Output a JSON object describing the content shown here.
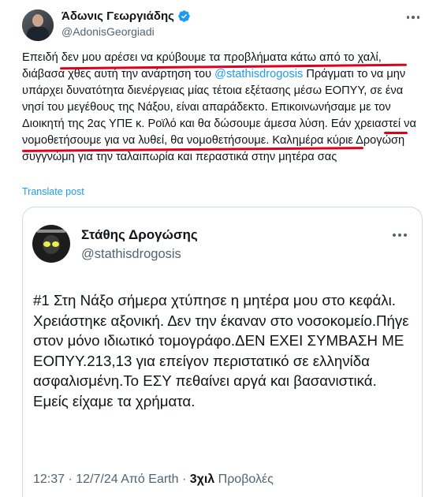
{
  "tweet": {
    "author_name": "Άδωνις Γεωργιάδης",
    "author_handle": "@AdonisGeorgiadi",
    "text_segments": [
      "Επειδή ",
      "δεν μου αρέσει να κρύβουμε τα προβλήματα κάτω από το χαλί",
      ", διάβασα χθες αυτή την ανάρτηση του ",
      "@stathisdrogosis",
      " Πράγματι το να μην υπάρχει δυνατότητα διενέργειας μίας τέτοια εξέτασης μέσω ΕΟΠΥΥ, σε ένα νησί του μεγέθους της Νάξου, είναι απαράδεκτο. Επικοινωνήσαμε με τον Διοικητή της 2ας ΥΠΕ κ. Ροϊλό και θα δώσουμε άμεσα λύση. ",
      "Εάν χρειαστεί να νομοθετήσουμε για να λυθεί, θα νομοθετήσουμε.",
      " Καλημέρα κύριε Δρογώση συγγνώμη για την ταλαιπωρία και περαστικά στην μητέρα σας"
    ],
    "translate_label": "Translate post"
  },
  "quoted": {
    "author_name": "Στάθης Δρογώσης",
    "author_handle": "@stathisdrogosis",
    "text": "#1 Στη Νάξο σήμερα χτύπησε η μητέρα μου στο κεφάλι. Χρειάστηκε αξονική. Δεν την έκαναν στο νοσοκομείο.Πήγε στον μόνο ιδιωτικό τομογράφο.ΔΕΝ ΕΧΕΙ ΣΥΜΒΑΣΗ ΜΕ ΕΟΠΥΥ.213,13 για επείγον περιστατικό σε ελληνίδα ασφαλισμένη.Το ΕΣΥ πεθαίνει αργά και βασανιστικά. Εμείς είχαμε τα χρήματα.",
    "time": "12:37",
    "date": "12/7/24",
    "source": "Από Earth",
    "views_count": "3χιλ",
    "views_label": "Προβολές"
  },
  "colors": {
    "link": "#1d9bf0",
    "verified_badge": "#1d9bf0",
    "annotation_underline": "#e0001b",
    "secondary_text": "#536471"
  }
}
